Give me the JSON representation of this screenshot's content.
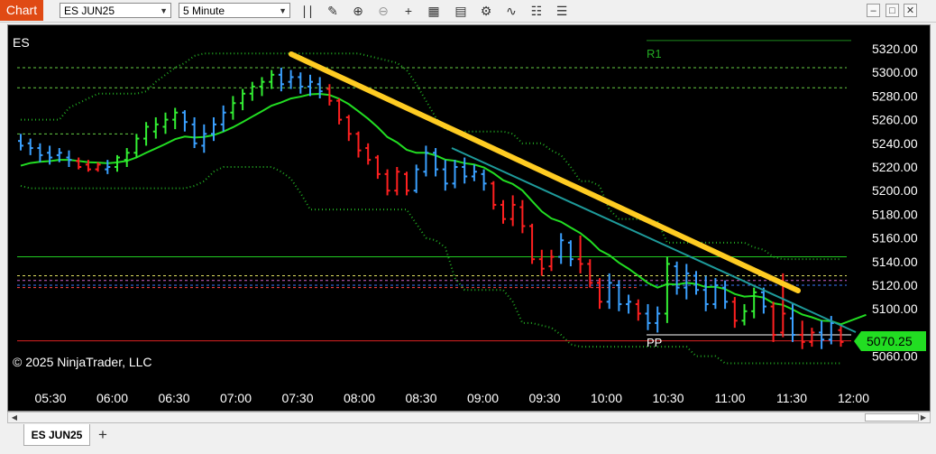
{
  "window": {
    "app_label": "Chart",
    "instrument": "ES JUN25",
    "interval": "5 Minute",
    "tab_label": "ES JUN25",
    "add_tab_label": "+",
    "minimize": "–",
    "restore": "□",
    "close": "✕"
  },
  "toolbar": {
    "icons": [
      "bar-type-icon",
      "draw-pencil-icon",
      "zoom-in-icon",
      "zoom-out-icon",
      "crosshair-icon",
      "data-box-icon",
      "indicators-icon",
      "strategies-icon",
      "drawing-tools-icon",
      "properties-icon"
    ]
  },
  "chart": {
    "symbol_label": "ES",
    "copyright": "© 2025 NinjaTrader, LLC",
    "last_price_label": "5070.25",
    "pivot_labels": {
      "r1": "R1",
      "pp": "PP"
    },
    "colors": {
      "background": "#000000",
      "bar_up": "#3aa0ff",
      "bar_down": "#ff2020",
      "bar_trend_up": "#33ee33",
      "ema": "#22dd22",
      "bands": "#22aa22",
      "trendline_yellow": "#ffcc22",
      "trendline_teal": "#1e9a9a",
      "last_price": "#22dd22"
    }
  },
  "chart_data": {
    "type": "candlestick",
    "instrument": "ES JUN25",
    "interval": "5 Minute",
    "y_range": [
      5055,
      5330
    ],
    "y_ticks": [
      "5320.00",
      "5300.00",
      "5280.00",
      "5260.00",
      "5240.00",
      "5220.00",
      "5200.00",
      "5180.00",
      "5160.00",
      "5140.00",
      "5120.00",
      "5100.00",
      "5080.00",
      "5060.00"
    ],
    "x_ticks": [
      "05:30",
      "06:00",
      "06:30",
      "07:00",
      "07:30",
      "08:00",
      "08:30",
      "09:00",
      "09:30",
      "10:00",
      "10:30",
      "11:00",
      "11:30",
      "12:00"
    ],
    "last_price": 5070.25,
    "levels": {
      "R1": 5327,
      "PP": 5078,
      "horizontal_lines": [
        5304,
        5287,
        5248,
        5144,
        5128,
        5124,
        5120,
        5118,
        5073
      ]
    },
    "bars": [
      {
        "o": 5242,
        "h": 5248,
        "l": 5234,
        "c": 5238,
        "k": "u"
      },
      {
        "o": 5240,
        "h": 5244,
        "l": 5230,
        "c": 5236,
        "k": "u"
      },
      {
        "o": 5236,
        "h": 5240,
        "l": 5224,
        "c": 5230,
        "k": "u"
      },
      {
        "o": 5232,
        "h": 5238,
        "l": 5222,
        "c": 5228,
        "k": "u"
      },
      {
        "o": 5230,
        "h": 5236,
        "l": 5224,
        "c": 5232,
        "k": "u"
      },
      {
        "o": 5228,
        "h": 5234,
        "l": 5220,
        "c": 5226,
        "k": "u"
      },
      {
        "o": 5225,
        "h": 5228,
        "l": 5218,
        "c": 5220,
        "k": "d"
      },
      {
        "o": 5222,
        "h": 5226,
        "l": 5216,
        "c": 5218,
        "k": "d"
      },
      {
        "o": 5218,
        "h": 5224,
        "l": 5216,
        "c": 5222,
        "k": "d"
      },
      {
        "o": 5218,
        "h": 5226,
        "l": 5214,
        "c": 5220,
        "k": "u"
      },
      {
        "o": 5220,
        "h": 5230,
        "l": 5216,
        "c": 5228,
        "k": "g"
      },
      {
        "o": 5226,
        "h": 5236,
        "l": 5220,
        "c": 5232,
        "k": "g"
      },
      {
        "o": 5232,
        "h": 5248,
        "l": 5228,
        "c": 5244,
        "k": "g"
      },
      {
        "o": 5244,
        "h": 5258,
        "l": 5238,
        "c": 5254,
        "k": "g"
      },
      {
        "o": 5250,
        "h": 5262,
        "l": 5244,
        "c": 5256,
        "k": "g"
      },
      {
        "o": 5254,
        "h": 5266,
        "l": 5248,
        "c": 5260,
        "k": "g"
      },
      {
        "o": 5260,
        "h": 5270,
        "l": 5252,
        "c": 5266,
        "k": "g"
      },
      {
        "o": 5266,
        "h": 5268,
        "l": 5250,
        "c": 5258,
        "k": "u"
      },
      {
        "o": 5256,
        "h": 5262,
        "l": 5236,
        "c": 5240,
        "k": "u"
      },
      {
        "o": 5238,
        "h": 5256,
        "l": 5232,
        "c": 5248,
        "k": "u"
      },
      {
        "o": 5248,
        "h": 5262,
        "l": 5242,
        "c": 5256,
        "k": "u"
      },
      {
        "o": 5256,
        "h": 5272,
        "l": 5250,
        "c": 5266,
        "k": "u"
      },
      {
        "o": 5266,
        "h": 5280,
        "l": 5260,
        "c": 5274,
        "k": "g"
      },
      {
        "o": 5274,
        "h": 5286,
        "l": 5268,
        "c": 5282,
        "k": "g"
      },
      {
        "o": 5282,
        "h": 5292,
        "l": 5276,
        "c": 5288,
        "k": "g"
      },
      {
        "o": 5288,
        "h": 5296,
        "l": 5280,
        "c": 5292,
        "k": "g"
      },
      {
        "o": 5292,
        "h": 5302,
        "l": 5286,
        "c": 5298,
        "k": "g"
      },
      {
        "o": 5298,
        "h": 5304,
        "l": 5284,
        "c": 5290,
        "k": "u"
      },
      {
        "o": 5292,
        "h": 5302,
        "l": 5286,
        "c": 5296,
        "k": "u"
      },
      {
        "o": 5296,
        "h": 5300,
        "l": 5282,
        "c": 5288,
        "k": "u"
      },
      {
        "o": 5288,
        "h": 5298,
        "l": 5280,
        "c": 5292,
        "k": "u"
      },
      {
        "o": 5290,
        "h": 5296,
        "l": 5278,
        "c": 5284,
        "k": "u"
      },
      {
        "o": 5286,
        "h": 5290,
        "l": 5272,
        "c": 5276,
        "k": "d"
      },
      {
        "o": 5276,
        "h": 5278,
        "l": 5256,
        "c": 5260,
        "k": "d"
      },
      {
        "o": 5262,
        "h": 5264,
        "l": 5242,
        "c": 5248,
        "k": "d"
      },
      {
        "o": 5248,
        "h": 5250,
        "l": 5228,
        "c": 5234,
        "k": "d"
      },
      {
        "o": 5236,
        "h": 5240,
        "l": 5222,
        "c": 5226,
        "k": "d"
      },
      {
        "o": 5228,
        "h": 5230,
        "l": 5210,
        "c": 5214,
        "k": "d"
      },
      {
        "o": 5214,
        "h": 5218,
        "l": 5196,
        "c": 5200,
        "k": "d"
      },
      {
        "o": 5200,
        "h": 5220,
        "l": 5196,
        "c": 5216,
        "k": "d"
      },
      {
        "o": 5214,
        "h": 5216,
        "l": 5196,
        "c": 5200,
        "k": "d"
      },
      {
        "o": 5200,
        "h": 5222,
        "l": 5198,
        "c": 5218,
        "k": "u"
      },
      {
        "o": 5216,
        "h": 5238,
        "l": 5212,
        "c": 5232,
        "k": "u"
      },
      {
        "o": 5232,
        "h": 5236,
        "l": 5212,
        "c": 5218,
        "k": "u"
      },
      {
        "o": 5218,
        "h": 5226,
        "l": 5200,
        "c": 5206,
        "k": "u"
      },
      {
        "o": 5206,
        "h": 5226,
        "l": 5202,
        "c": 5220,
        "k": "u"
      },
      {
        "o": 5220,
        "h": 5228,
        "l": 5206,
        "c": 5212,
        "k": "u"
      },
      {
        "o": 5212,
        "h": 5222,
        "l": 5208,
        "c": 5216,
        "k": "u"
      },
      {
        "o": 5214,
        "h": 5218,
        "l": 5200,
        "c": 5206,
        "k": "u"
      },
      {
        "o": 5206,
        "h": 5208,
        "l": 5184,
        "c": 5188,
        "k": "d"
      },
      {
        "o": 5188,
        "h": 5192,
        "l": 5172,
        "c": 5176,
        "k": "d"
      },
      {
        "o": 5176,
        "h": 5196,
        "l": 5170,
        "c": 5188,
        "k": "d"
      },
      {
        "o": 5186,
        "h": 5192,
        "l": 5164,
        "c": 5170,
        "k": "d"
      },
      {
        "o": 5170,
        "h": 5172,
        "l": 5138,
        "c": 5142,
        "k": "d"
      },
      {
        "o": 5142,
        "h": 5150,
        "l": 5128,
        "c": 5134,
        "k": "d"
      },
      {
        "o": 5136,
        "h": 5150,
        "l": 5132,
        "c": 5144,
        "k": "d"
      },
      {
        "o": 5144,
        "h": 5164,
        "l": 5138,
        "c": 5158,
        "k": "u"
      },
      {
        "o": 5156,
        "h": 5158,
        "l": 5136,
        "c": 5142,
        "k": "u"
      },
      {
        "o": 5142,
        "h": 5162,
        "l": 5130,
        "c": 5138,
        "k": "d"
      },
      {
        "o": 5138,
        "h": 5142,
        "l": 5118,
        "c": 5122,
        "k": "d"
      },
      {
        "o": 5122,
        "h": 5126,
        "l": 5100,
        "c": 5106,
        "k": "d"
      },
      {
        "o": 5106,
        "h": 5130,
        "l": 5100,
        "c": 5122,
        "k": "u"
      },
      {
        "o": 5120,
        "h": 5124,
        "l": 5098,
        "c": 5104,
        "k": "u"
      },
      {
        "o": 5104,
        "h": 5112,
        "l": 5096,
        "c": 5106,
        "k": "u"
      },
      {
        "o": 5104,
        "h": 5108,
        "l": 5090,
        "c": 5096,
        "k": "d"
      },
      {
        "o": 5096,
        "h": 5104,
        "l": 5082,
        "c": 5088,
        "k": "u"
      },
      {
        "o": 5088,
        "h": 5102,
        "l": 5080,
        "c": 5096,
        "k": "u"
      },
      {
        "o": 5096,
        "h": 5144,
        "l": 5088,
        "c": 5138,
        "k": "g"
      },
      {
        "o": 5136,
        "h": 5140,
        "l": 5112,
        "c": 5118,
        "k": "u"
      },
      {
        "o": 5118,
        "h": 5138,
        "l": 5108,
        "c": 5130,
        "k": "u"
      },
      {
        "o": 5128,
        "h": 5132,
        "l": 5112,
        "c": 5116,
        "k": "u"
      },
      {
        "o": 5116,
        "h": 5128,
        "l": 5098,
        "c": 5104,
        "k": "u"
      },
      {
        "o": 5104,
        "h": 5126,
        "l": 5100,
        "c": 5120,
        "k": "u"
      },
      {
        "o": 5118,
        "h": 5124,
        "l": 5100,
        "c": 5106,
        "k": "u"
      },
      {
        "o": 5106,
        "h": 5110,
        "l": 5084,
        "c": 5090,
        "k": "d"
      },
      {
        "o": 5090,
        "h": 5104,
        "l": 5086,
        "c": 5098,
        "k": "g"
      },
      {
        "o": 5098,
        "h": 5118,
        "l": 5092,
        "c": 5114,
        "k": "g"
      },
      {
        "o": 5114,
        "h": 5118,
        "l": 5096,
        "c": 5102,
        "k": "u"
      },
      {
        "o": 5102,
        "h": 5106,
        "l": 5072,
        "c": 5078,
        "k": "d"
      },
      {
        "o": 5080,
        "h": 5130,
        "l": 5076,
        "c": 5096,
        "k": "d"
      },
      {
        "o": 5092,
        "h": 5104,
        "l": 5072,
        "c": 5078,
        "k": "u"
      },
      {
        "o": 5078,
        "h": 5090,
        "l": 5066,
        "c": 5072,
        "k": "d"
      },
      {
        "o": 5072,
        "h": 5084,
        "l": 5068,
        "c": 5080,
        "k": "d"
      },
      {
        "o": 5080,
        "h": 5090,
        "l": 5066,
        "c": 5074,
        "k": "u"
      },
      {
        "o": 5074,
        "h": 5094,
        "l": 5070,
        "c": 5088,
        "k": "u"
      },
      {
        "o": 5082,
        "h": 5086,
        "l": 5068,
        "c": 5072,
        "k": "d"
      }
    ]
  }
}
